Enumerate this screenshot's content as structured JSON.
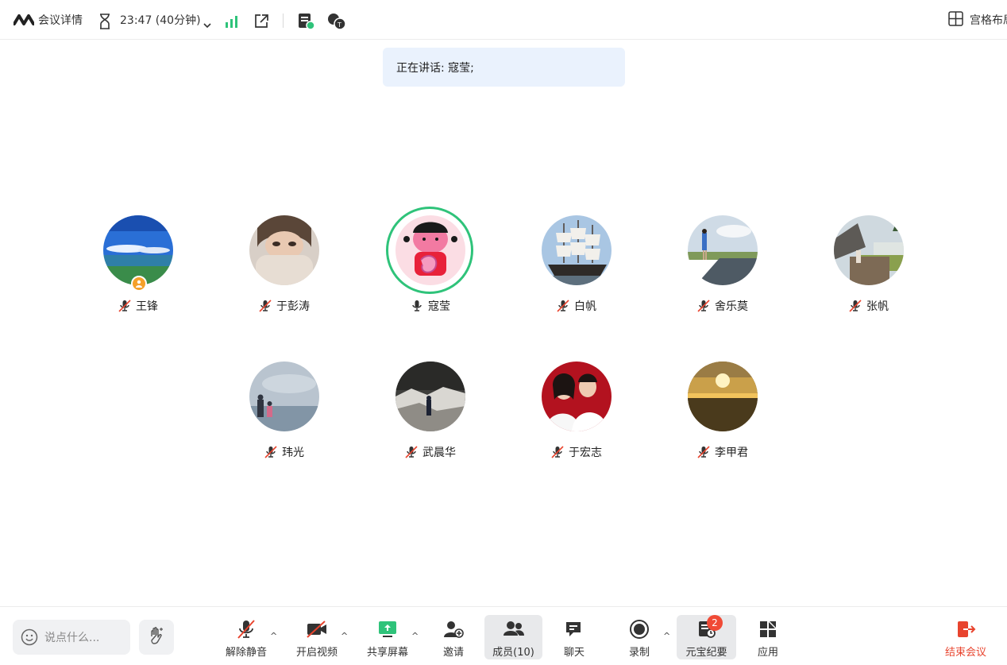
{
  "topbar": {
    "meeting_detail_label": "会议详情",
    "timer_text": "23:47 (40分钟)",
    "layout_label": "宫格布局"
  },
  "speaking_banner": "正在讲话: 寇莹;",
  "participants": [
    {
      "name": "王锋",
      "avatar": "landscape-lake-icon",
      "muted": true,
      "host": true
    },
    {
      "name": "于彭涛",
      "avatar": "face-photo-icon",
      "muted": true
    },
    {
      "name": "寇莹",
      "avatar": "cartoon-girl-icon",
      "muted": false,
      "speaking": true
    },
    {
      "name": "白帆",
      "avatar": "sailing-ship-icon",
      "muted": true
    },
    {
      "name": "舍乐莫",
      "avatar": "road-person-icon",
      "muted": true
    },
    {
      "name": "张帆",
      "avatar": "rooftop-photo-icon",
      "muted": true
    },
    {
      "name": "玮光",
      "avatar": "seaside-couple-icon",
      "muted": true
    },
    {
      "name": "武晨华",
      "avatar": "rocks-person-icon",
      "muted": true
    },
    {
      "name": "于宏志",
      "avatar": "couple-photo-icon",
      "muted": true
    },
    {
      "name": "李甲君",
      "avatar": "sunset-icon",
      "muted": true
    }
  ],
  "bottombar": {
    "chat_placeholder": "说点什么...",
    "unmute_label": "解除静音",
    "video_label": "开启视频",
    "share_label": "共享屏幕",
    "invite_label": "邀请",
    "members_label": "成员(10)",
    "chat_label": "聊天",
    "record_label": "录制",
    "summary_label": "元宝纪要",
    "summary_badge": "2",
    "apps_label": "应用",
    "end_label": "结束会议"
  },
  "colors": {
    "accent_green": "#2fc37a",
    "banner_bg": "#eaf2fd",
    "end_red": "#e8442e",
    "host_badge": "#f5a02a"
  }
}
